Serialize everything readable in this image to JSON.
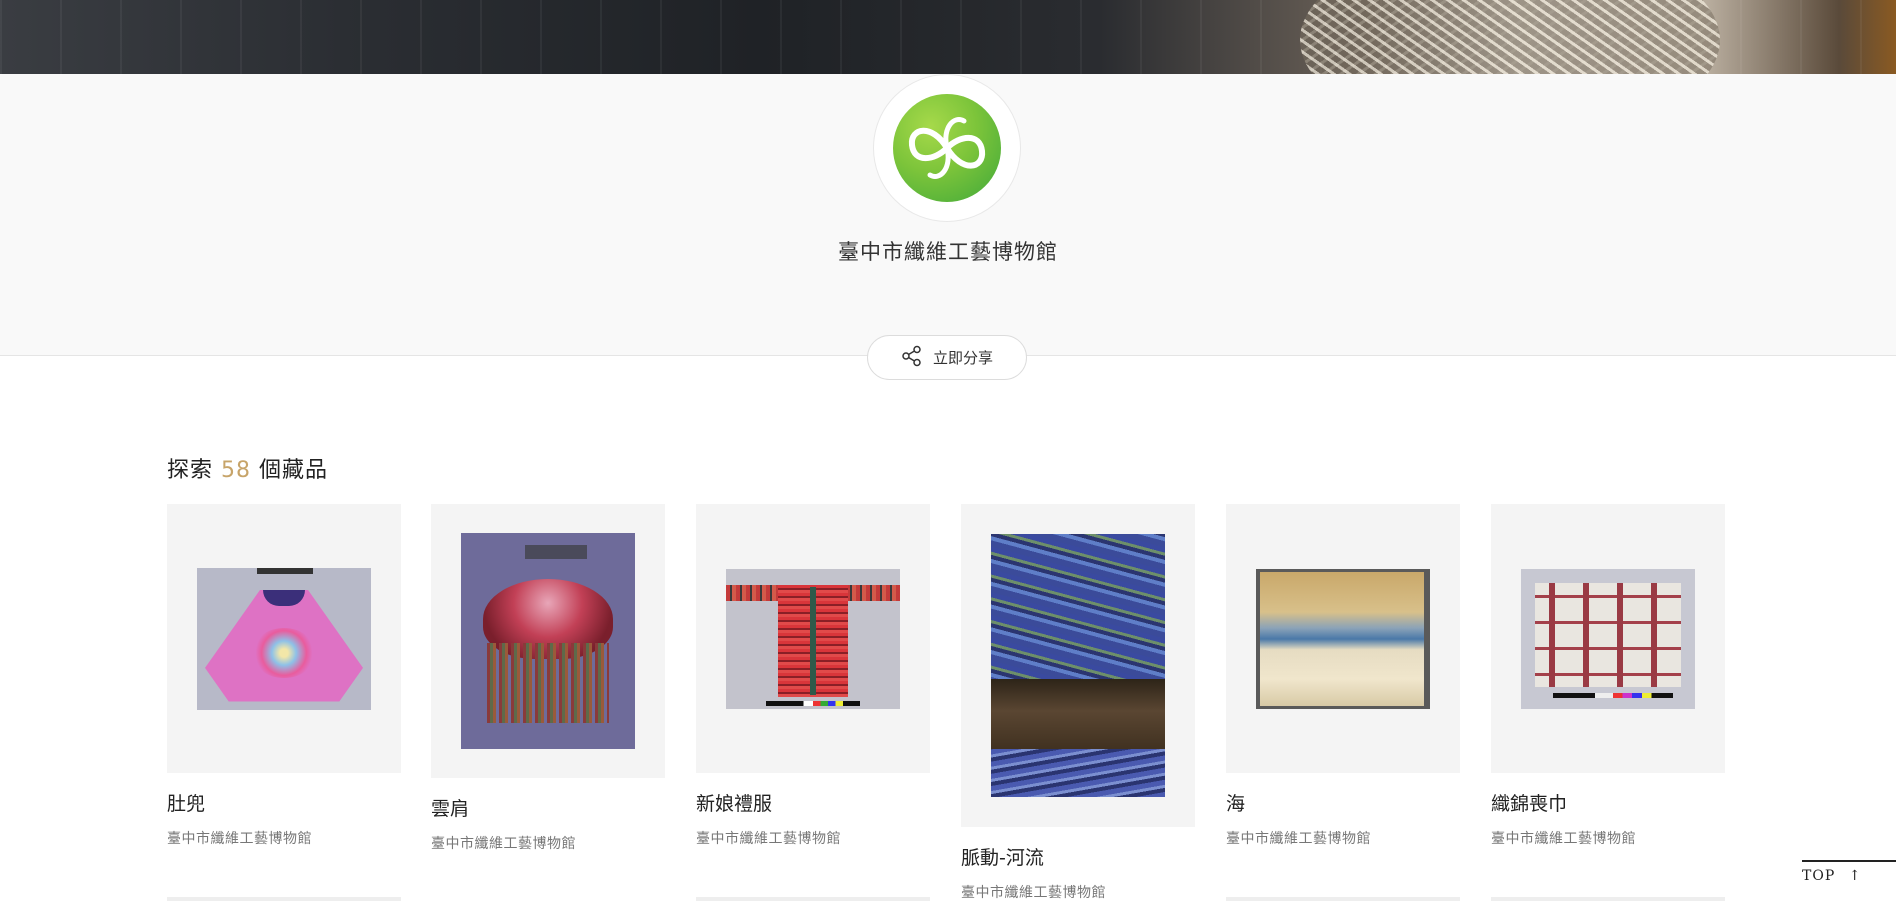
{
  "museum": {
    "name": "臺中市纖維工藝博物館"
  },
  "share": {
    "label": "立即分享"
  },
  "explore": {
    "prefix": "探索",
    "count": "58",
    "suffix": "個藏品"
  },
  "items": [
    {
      "title": "肚兜",
      "owner": "臺中市纖維工藝博物館"
    },
    {
      "title": "雲肩",
      "owner": "臺中市纖維工藝博物館"
    },
    {
      "title": "新娘禮服",
      "owner": "臺中市纖維工藝博物館"
    },
    {
      "title": "脈動-河流",
      "owner": "臺中市纖維工藝博物館"
    },
    {
      "title": "海",
      "owner": "臺中市纖維工藝博物館"
    },
    {
      "title": "織錦喪巾",
      "owner": "臺中市纖維工藝博物館"
    }
  ],
  "top_button": {
    "label": "TOP"
  },
  "colors": {
    "accent": "#c7a469",
    "logo_green": "#7cc43a",
    "header_bg": "#f9f9f9"
  }
}
